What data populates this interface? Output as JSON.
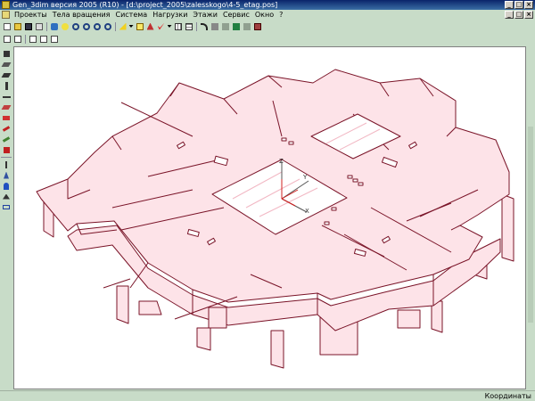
{
  "window": {
    "title": "Gen_3dim версия 2005 (R10) - [d:\\project_2005\\zalesskogo\\4-5_etag.pos]",
    "controls": [
      "_",
      "□",
      "×"
    ]
  },
  "menu": {
    "items": [
      {
        "label": "Проекты"
      },
      {
        "label": "Тела вращения"
      },
      {
        "label": "Система"
      },
      {
        "label": "Нагрузки"
      },
      {
        "label": "Этажи"
      },
      {
        "label": "Сервис"
      },
      {
        "label": "Окно"
      },
      {
        "label": "?"
      }
    ],
    "right_controls": [
      "_",
      "□",
      "×"
    ]
  },
  "toolbar_top": {
    "buttons": [
      "new-icon",
      "open-icon",
      "save-icon",
      "print-icon",
      "sep",
      "db-icon",
      "bulb-icon",
      "zoom-in-icon",
      "zoom-out-icon",
      "zoom-fit-icon",
      "zoom-window-icon",
      "sep",
      "arrow-yellow-icon",
      "dropdown-icon",
      "rect-yellow-icon",
      "view-a-icon",
      "tick-red-icon",
      "dropdown-icon",
      "grid-icon",
      "grid-icon",
      "sep",
      "redo-icon",
      "grid-small-icon",
      "cube-gray-icon",
      "cube-green-icon",
      "cube-gray-icon",
      "film-icon"
    ]
  },
  "toolbar_second": {
    "buttons": [
      "copy-icon",
      "select-icon",
      "sep",
      "window-icon",
      "window-icon",
      "window-icon"
    ]
  },
  "left_toolbar": {
    "buttons": [
      "node-icon",
      "slab-icon",
      "slab-icon",
      "column-icon",
      "beam-icon",
      "wall-icon",
      "wall-red-icon",
      "hatch-red-icon",
      "hatch-green-icon",
      "fill-red-icon",
      "sep",
      "load-icon",
      "load-icon",
      "person-icon",
      "support-icon",
      "measure-icon"
    ]
  },
  "axes": {
    "x": "X",
    "y": "Y",
    "z": "Z"
  },
  "status": {
    "text": "Координаты"
  },
  "colors": {
    "outline": "#7a1428",
    "fill": "#fde3e8",
    "axis_red": "#d02020",
    "ui_bg": "#c8dcc8"
  }
}
